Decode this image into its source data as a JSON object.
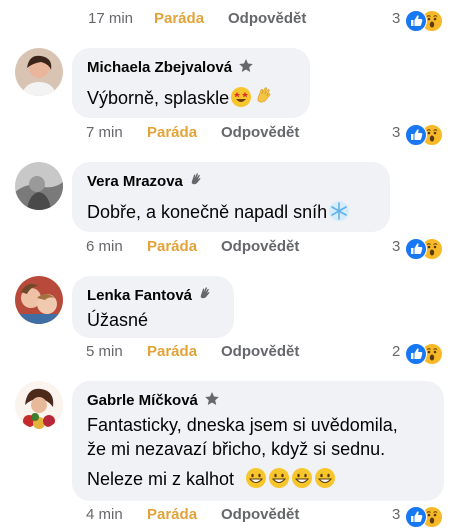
{
  "actions": {
    "react_label": "Paráda",
    "reply_label": "Odpovědět"
  },
  "comments": [
    {
      "time": "17 min",
      "reactions": "3"
    },
    {
      "author": "Michaela Zbejvalová",
      "text": "Výborně, splaskle",
      "time": "7 min",
      "reactions": "3"
    },
    {
      "author": "Vera Mrazova",
      "text": "Dobře, a konečně napadl sníh",
      "time": "6 min",
      "reactions": "3"
    },
    {
      "author": "Lenka Fantová",
      "text": "Úžasné",
      "time": "5 min",
      "reactions": "2"
    },
    {
      "author": "Gabrle Míčková",
      "text_lines": [
        "Fantasticky, dneska jsem si uvědomila,",
        "že mi nezavazí břicho, když si sednu.",
        "Neleze mi z kalhot"
      ],
      "time": "4 min",
      "reactions": "3"
    }
  ],
  "colors": {
    "react": "#e2a33a",
    "like": "#1877f2",
    "wow": "#f7b928",
    "bubble": "#f0f2f5",
    "meta": "#65676b"
  },
  "icons": {
    "top_fan": "star-badge-icon",
    "rising_fan": "wave-badge-icon",
    "like": "like-reaction-icon",
    "wow": "wow-reaction-icon"
  }
}
